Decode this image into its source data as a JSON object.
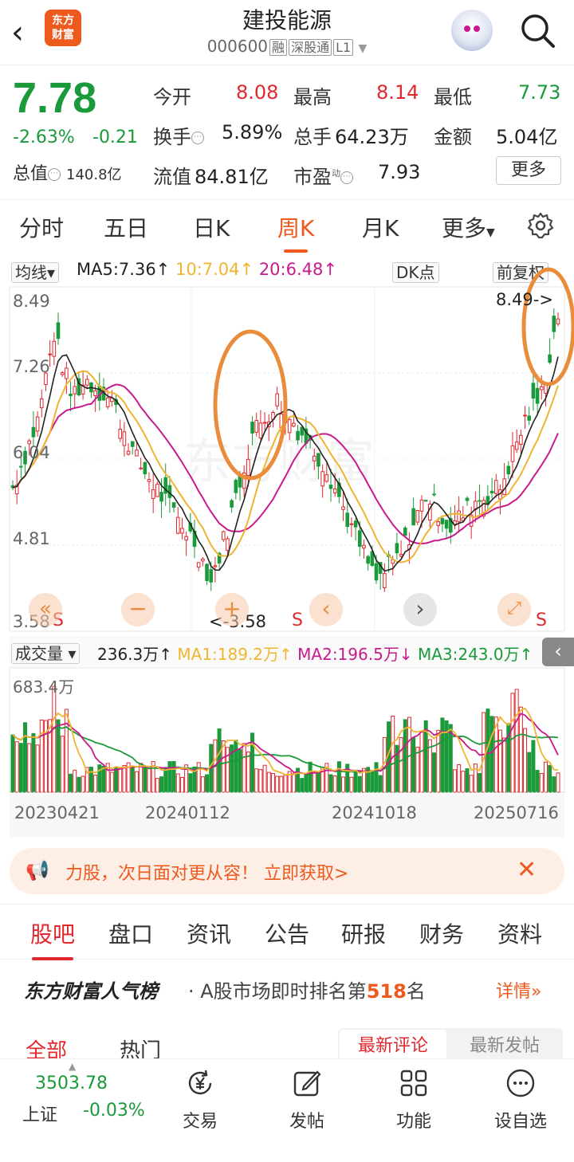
{
  "header": {
    "logo_text": "东方财富",
    "stock_name": "建投能源",
    "stock_code": "000600",
    "tags": [
      "融",
      "深股通",
      "L1"
    ]
  },
  "quote": {
    "price": "7.78",
    "change_pct": "-2.63%",
    "change": "-0.21",
    "open_label": "今开",
    "open": "8.08",
    "high_label": "最高",
    "high": "8.14",
    "low_label": "最低",
    "low": "7.73",
    "turnover_label": "换手",
    "turnover": "5.89%",
    "volume_label": "总手",
    "volume": "64.23万",
    "amount_label": "金额",
    "amount": "5.04亿",
    "total_cap_label": "总值",
    "total_cap": "140.8亿",
    "float_cap_label": "流值",
    "float_cap": "84.81亿",
    "pe_label": "市盈",
    "pe_sup": "动",
    "pe": "7.93",
    "more_label": "更多"
  },
  "chart_tabs": [
    "分时",
    "五日",
    "日K",
    "周K",
    "月K",
    "更多"
  ],
  "kline": {
    "ma_select": "均线",
    "ma5": "MA5:7.36↑",
    "ma10": "10:7.04↑",
    "ma20": "20:6.48↑",
    "dk_label": "DK点",
    "adj_label": "前复权",
    "y_ticks": [
      "8.49",
      "7.26",
      "6.04",
      "4.81",
      "3.58"
    ],
    "high_marker": "8.49->",
    "low_marker": "<-3.58",
    "s_label": "S"
  },
  "volume": {
    "select": "成交量",
    "value": "236.3万↑",
    "ma1": "MA1:189.2万↑",
    "ma2": "MA2:196.5万↓",
    "ma3": "MA3:243.0万↑",
    "max_label": "683.4万",
    "dates": [
      "20230421",
      "20240112",
      "20241018",
      "20250716"
    ]
  },
  "banner": {
    "text": "力股，次日面对更从容！ 立即获取>"
  },
  "bottom_tabs": [
    "股吧",
    "盘口",
    "资讯",
    "公告",
    "研报",
    "财务",
    "资料"
  ],
  "rank": {
    "title": "东方财富人气榜",
    "text_pre": "A股市场即时排名第",
    "rank": "518",
    "text_post": "名",
    "detail": "详情"
  },
  "feed_tabs": [
    "全部",
    "热门",
    "最新评论",
    "最新发帖"
  ],
  "nav": {
    "index_value": "3503.78",
    "index_name": "上证",
    "index_change": "-0.03%",
    "items": [
      "交易",
      "发帖",
      "功能",
      "设自选"
    ]
  },
  "colors": {
    "up": "#e0282e",
    "down": "#1a9a3a",
    "accent": "#ee5a1e",
    "ma5": "#222222",
    "ma10": "#f0b431",
    "ma20": "#c81a8c"
  }
}
